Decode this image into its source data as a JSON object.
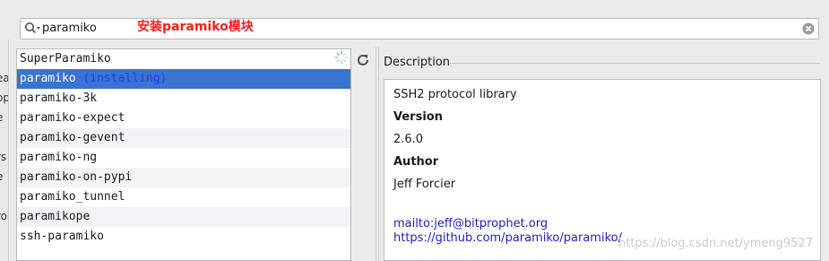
{
  "search": {
    "value": "paramiko",
    "annotation": "安装paramiko模块"
  },
  "packages": [
    {
      "name": "SuperParamiko",
      "status": ""
    },
    {
      "name": "paramiko",
      "status": "(installing)"
    },
    {
      "name": "paramiko-3k",
      "status": ""
    },
    {
      "name": "paramiko-expect",
      "status": ""
    },
    {
      "name": "paramiko-gevent",
      "status": ""
    },
    {
      "name": "paramiko-ng",
      "status": ""
    },
    {
      "name": "paramiko-on-pypi",
      "status": ""
    },
    {
      "name": "paramiko_tunnel",
      "status": ""
    },
    {
      "name": "paramikope",
      "status": ""
    },
    {
      "name": "ssh-paramiko",
      "status": ""
    }
  ],
  "selected_package": "paramiko",
  "left_edge_glyphs": [
    "ea",
    "op",
    "e",
    "rs",
    "e",
    "ro"
  ],
  "description": {
    "title": "Description",
    "summary": "SSH2 protocol library",
    "version_label": "Version",
    "version": "2.6.0",
    "author_label": "Author",
    "author": "Jeff Forcier",
    "email_link": "mailto:jeff@bitprophet.org",
    "homepage_link": "https://github.com/paramiko/paramiko/"
  },
  "watermark": "https://blog.csdn.net/ymeng9527",
  "colors": {
    "selection": "#3874d0",
    "annotation": "#ff1a1a",
    "link": "#1c1cc8",
    "status": "#1e40ff"
  },
  "icons": {
    "search": "search-icon",
    "clear": "clear-icon",
    "spinner": "spinner-icon",
    "refresh": "refresh-icon"
  }
}
